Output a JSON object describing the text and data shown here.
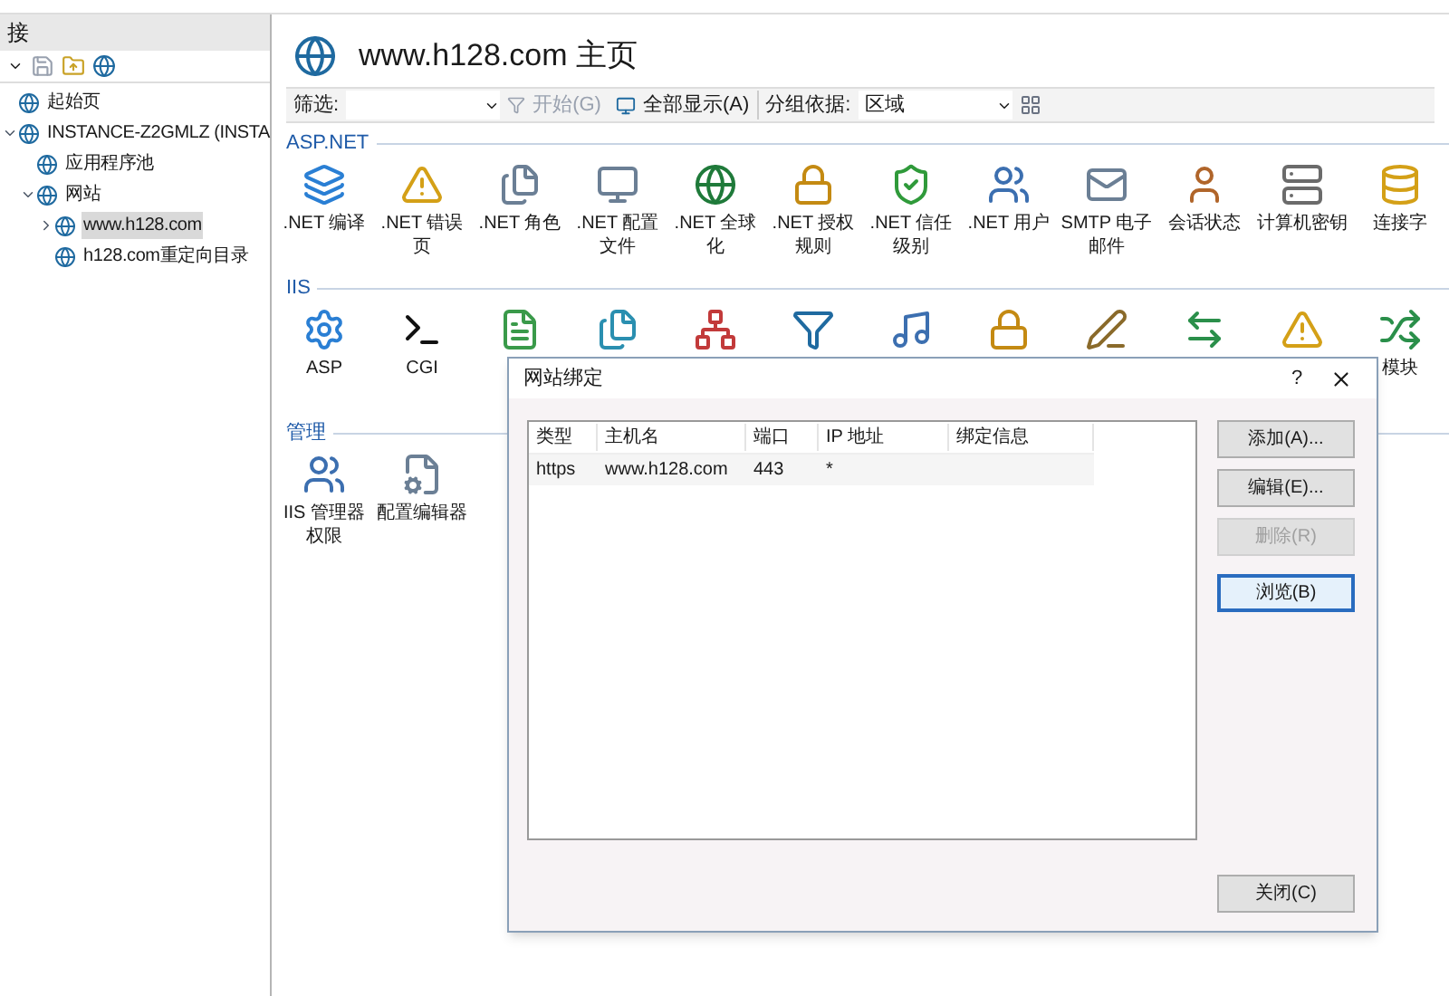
{
  "connections": {
    "title": "接",
    "tree": [
      {
        "label": "起始页",
        "selected": false
      },
      {
        "label": "INSTANCE-Z2GMLZ (INSTA",
        "selected": false,
        "expanded": true,
        "children": [
          {
            "label": "应用程序池",
            "selected": false
          },
          {
            "label": "网站",
            "selected": false,
            "expanded": true,
            "children": [
              {
                "label": "www.h128.com",
                "selected": true,
                "expanded": false
              },
              {
                "label": "h128.com重定向目录",
                "selected": false
              }
            ]
          }
        ]
      }
    ]
  },
  "page": {
    "title": "www.h128.com 主页",
    "filter": {
      "label": "筛选:",
      "start": "开始(G)",
      "show_all": "全部显示(A)",
      "group_label": "分组依据:",
      "group_value": "区域"
    },
    "sections": [
      {
        "name": "ASP.NET",
        "items": [
          {
            "label": ".NET 编译"
          },
          {
            "label": ".NET 错误页"
          },
          {
            "label": ".NET 角色"
          },
          {
            "label": ".NET 配置文件"
          },
          {
            "label": ".NET 全球化"
          },
          {
            "label": ".NET 授权规则"
          },
          {
            "label": ".NET 信任级别"
          },
          {
            "label": ".NET 用户"
          },
          {
            "label": "SMTP 电子邮件"
          },
          {
            "label": "会话状态"
          },
          {
            "label": "计算机密钥"
          },
          {
            "label": "连接字"
          }
        ]
      },
      {
        "name": "IIS",
        "items": [
          {
            "kind": "labeled",
            "label": "ASP"
          },
          {
            "kind": "labeled",
            "label": "CGI"
          },
          {
            "kind": "icon_only"
          },
          {
            "kind": "icon_only"
          },
          {
            "kind": "icon_only"
          },
          {
            "kind": "icon_only"
          },
          {
            "kind": "icon_only"
          },
          {
            "kind": "icon_only"
          },
          {
            "kind": "icon_only"
          },
          {
            "kind": "icon_only"
          },
          {
            "kind": "icon_only"
          },
          {
            "kind": "labeled",
            "label": "模块"
          }
        ]
      },
      {
        "name": "管理",
        "items": [
          {
            "label": "IIS 管理器权限"
          },
          {
            "label": "配置编辑器"
          }
        ]
      }
    ]
  },
  "dialog": {
    "title": "网站绑定",
    "help": "?",
    "columns": [
      "类型",
      "主机名",
      "端口",
      "IP 地址",
      "绑定信息"
    ],
    "rows": [
      [
        "https",
        "www.h128.com",
        "443",
        "*",
        ""
      ]
    ],
    "buttons": [
      {
        "label": "添加(A)...",
        "disabled": false,
        "focused": false
      },
      {
        "label": "编辑(E)...",
        "disabled": false,
        "focused": false
      },
      {
        "label": "删除(R)",
        "disabled": true,
        "focused": false
      },
      {
        "label": "浏览(B)",
        "disabled": false,
        "focused": true
      }
    ],
    "close": "关闭(C)"
  }
}
